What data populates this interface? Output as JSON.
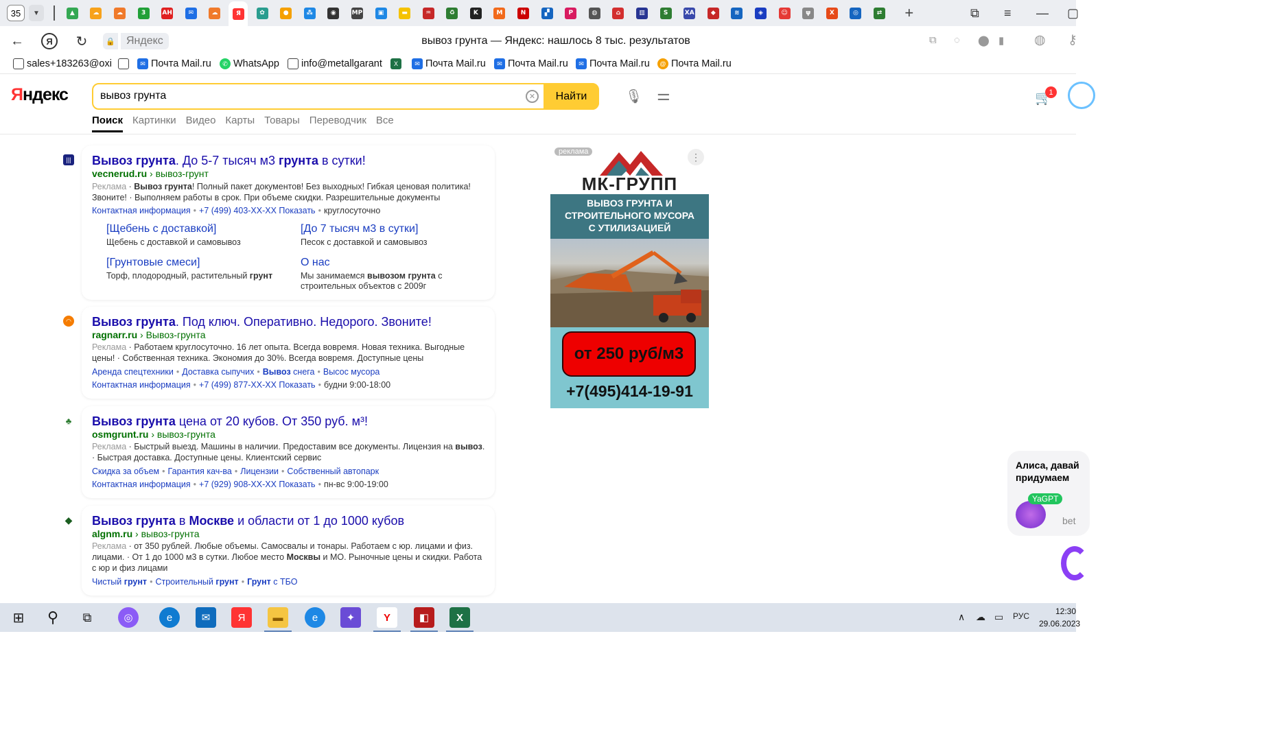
{
  "browser": {
    "tab_count": "35",
    "page_title": "вывоз грунта — Яндекс: нашлось 8 тыс. результатов",
    "host": "Яндекс",
    "tab_icons": [
      {
        "icon": "drive-icon",
        "color": "#34a853",
        "glyph": "▲"
      },
      {
        "icon": "cloud-icon",
        "color": "#f7a21b",
        "glyph": "☁"
      },
      {
        "icon": "cloud-icon",
        "color": "#f07a2b",
        "glyph": "☁"
      },
      {
        "icon": "number3-icon",
        "color": "#21a038",
        "glyph": "3"
      },
      {
        "icon": "ah-icon",
        "color": "#e02020",
        "glyph": "АН"
      },
      {
        "icon": "mail-icon",
        "color": "#1f6fe5",
        "glyph": "✉"
      },
      {
        "icon": "cloud-icon",
        "color": "#f07a2b",
        "glyph": "☁"
      },
      {
        "icon": "yandex-icon",
        "color": "#f33",
        "glyph": "Я"
      },
      {
        "icon": "gear-flower-icon",
        "color": "#2a9d8f",
        "glyph": "✿"
      },
      {
        "icon": "oval-logo-icon",
        "color": "#f5a000",
        "glyph": "●"
      },
      {
        "icon": "apps-icon",
        "color": "#1e88e5",
        "glyph": "⁂"
      },
      {
        "icon": "radio-icon",
        "color": "#333",
        "glyph": "◉"
      },
      {
        "icon": "mp-icon",
        "color": "#444",
        "glyph": "MP"
      },
      {
        "icon": "doc-icon",
        "color": "#1e88e5",
        "glyph": "▣"
      },
      {
        "icon": "tag-icon",
        "color": "#f5c200",
        "glyph": "▬"
      },
      {
        "icon": "chart-icon",
        "color": "#c62828",
        "glyph": "♒"
      },
      {
        "icon": "recycle-icon",
        "color": "#2e7d32",
        "glyph": "♻"
      },
      {
        "icon": "k-icon",
        "color": "#222",
        "glyph": "K"
      },
      {
        "icon": "m-icon",
        "color": "#f26a1b",
        "glyph": "M"
      },
      {
        "icon": "n-icon",
        "color": "#c00",
        "glyph": "N"
      },
      {
        "icon": "blocks-icon",
        "color": "#1565c0",
        "glyph": "▞"
      },
      {
        "icon": "p-icon",
        "color": "#d81b60",
        "glyph": "P"
      },
      {
        "icon": "globe-icon",
        "color": "#555",
        "glyph": "◍"
      },
      {
        "icon": "home-icon",
        "color": "#d32f2f",
        "glyph": "⌂"
      },
      {
        "icon": "books-icon",
        "color": "#283593",
        "glyph": "▥"
      },
      {
        "icon": "s-icon",
        "color": "#2e7d32",
        "glyph": "S"
      },
      {
        "icon": "xa-icon",
        "color": "#3949ab",
        "glyph": "XA"
      },
      {
        "icon": "shield-red-icon",
        "color": "#c62828",
        "glyph": "◆"
      },
      {
        "icon": "waves-icon",
        "color": "#1565c0",
        "glyph": "≋"
      },
      {
        "icon": "diamond-icon",
        "color": "#1a3dc1",
        "glyph": "◈"
      },
      {
        "icon": "face-icon",
        "color": "#e53935",
        "glyph": "☺"
      },
      {
        "icon": "grass-icon",
        "color": "#888",
        "glyph": "ψ"
      },
      {
        "icon": "x-icon",
        "color": "#e64a19",
        "glyph": "X"
      },
      {
        "icon": "circle-icon",
        "color": "#1565c0",
        "glyph": "◎"
      },
      {
        "icon": "arrows-icon",
        "color": "#2e7d32",
        "glyph": "⇄"
      }
    ]
  },
  "bookmarks": [
    {
      "label": "sales+183263@oxi",
      "icon": "doc-icon"
    },
    {
      "label": "",
      "icon": "doc-icon"
    },
    {
      "label": "Почта Mail.ru",
      "icon": "mail-icon"
    },
    {
      "label": "WhatsApp",
      "icon": "whatsapp-icon"
    },
    {
      "label": "info@metallgarant",
      "icon": "doc-icon"
    },
    {
      "label": "",
      "icon": "excel-icon"
    },
    {
      "label": "Почта Mail.ru",
      "icon": "mail-icon"
    },
    {
      "label": "Почта Mail.ru",
      "icon": "mail-icon"
    },
    {
      "label": "Почта Mail.ru",
      "icon": "mail-icon"
    },
    {
      "label": "Почта Mail.ru",
      "icon": "at-icon"
    }
  ],
  "yandex": {
    "logo": "Яндекс",
    "query": "вывоз грунта",
    "search_button": "Найти",
    "tabs": [
      "Поиск",
      "Картинки",
      "Видео",
      "Карты",
      "Товары",
      "Переводчик",
      "Все"
    ],
    "cart_count": "1"
  },
  "results": [
    {
      "title_bold": "Вывоз грунта",
      "title_rest": ". До 5-7 тысяч м3 ",
      "title_bold2": "грунта",
      "title_rest2": " в сутки!",
      "domain": "vecnerud.ru",
      "path": " › вывоз-грунт",
      "ad_label": "Реклама",
      "text_bold": "Вывоз грунта",
      "text": "! Полный пакет документов! Без выходных! Гибкая ценовая политика! Звоните! · Выполняем работы в срок. При объеме скидки. Разрешительные документы",
      "contact": "Контактная информация",
      "phone": "+7 (499) 403-XX-XX Показать",
      "hours": "круглосуточно",
      "sitelinks": [
        {
          "title": "[Щебень с доставкой]",
          "desc": "Щебень с доставкой и самовывоз"
        },
        {
          "title": "[До 7 тысяч м3 в сутки]",
          "desc": "Песок с доставкой и самовывоз"
        },
        {
          "title": "[Грунтовые смеси]",
          "desc_pre": "Торф, плодородный, растительный ",
          "desc_bold": "грунт"
        },
        {
          "title": "О нас",
          "desc_pre": "Мы занимаемся ",
          "desc_bold": "вывозом грунта",
          "desc_post": " с строительных объектов с 2009г"
        }
      ]
    },
    {
      "title_bold": "Вывоз грунта",
      "title_rest": ". Под ключ. Оперативно. Недорого. Звоните!",
      "domain": "ragnarr.ru",
      "path": " › Вывоз-грунта",
      "ad_label": "Реклама",
      "text": " · Работаем круглосуточно. 16 лет опыта. Всегда вовремя. Новая техника. Выгодные цены! · Собственная техника. Экономия до 30%. Всегда вовремя. Доступные цены",
      "links": [
        "Аренда спецтехники",
        "Доставка сыпучих",
        "Вывоз",
        "снега",
        "Высос мусора"
      ],
      "contact": "Контактная информация",
      "phone": "+7 (499) 877-XX-XX Показать",
      "hours": "будни 9:00-18:00"
    },
    {
      "title_bold": "Вывоз грунта",
      "title_rest": " цена от 20 кубов. От 350 руб. м³!",
      "domain": "osmgrunt.ru",
      "path": " › вывоз-грунта",
      "ad_label": "Реклама",
      "text_pre": " · Быстрый выезд. Машины в наличии. Предоставим все документы. Лицензия на ",
      "text_bold": "вывоз",
      "text_post": ". · Быстрая доставка. Доступные цены. Клиентский сервис",
      "links": [
        "Скидка за объем",
        "Гарантия кач-ва",
        "Лицензии",
        "Собственный автопарк"
      ],
      "contact": "Контактная информация",
      "phone": "+7 (929) 908-XX-XX Показать",
      "hours": "пн-вс 9:00-19:00"
    },
    {
      "title_bold": "Вывоз грунта",
      "title_rest": " в ",
      "title_bold2": "Москве",
      "title_rest2": " и области от 1 до 1000 кубов",
      "domain": "algnm.ru",
      "path": " › вывоз-грунта",
      "ad_label": "Реклама",
      "text_pre": " · от 350 рублей. Любые объемы. Самосвалы и тонары. Работаем с юр. лицами и физ. лицами. · От 1 до 1000 м3 в сутки. Любое место ",
      "text_bold": "Москвы",
      "text_post": " и МО. Рыночные цены и скидки. Работа с юр и физ лицами",
      "links": [
        "Чистый",
        "грунт",
        "Строительный",
        "грунт",
        "Грунт",
        "с ТБО"
      ]
    }
  ],
  "ad_banner": {
    "tag": "реклама",
    "logo": "МК-ГРУПП",
    "headline": [
      "ВЫВОЗ ГРУНТА И",
      "СТРОИТЕЛЬНОГО МУСОРА",
      "С УТИЛИЗАЦИЕЙ"
    ],
    "price": "от 250 руб/м3",
    "phone": "+7(495)414-19-91"
  },
  "alice": {
    "line1": "Алиса, давай",
    "line2": "придумаем",
    "badge": "YaGPT",
    "hint": "bet"
  },
  "taskbar": {
    "lang": "РУС",
    "time": "12:30",
    "date": "29.06.2023"
  }
}
